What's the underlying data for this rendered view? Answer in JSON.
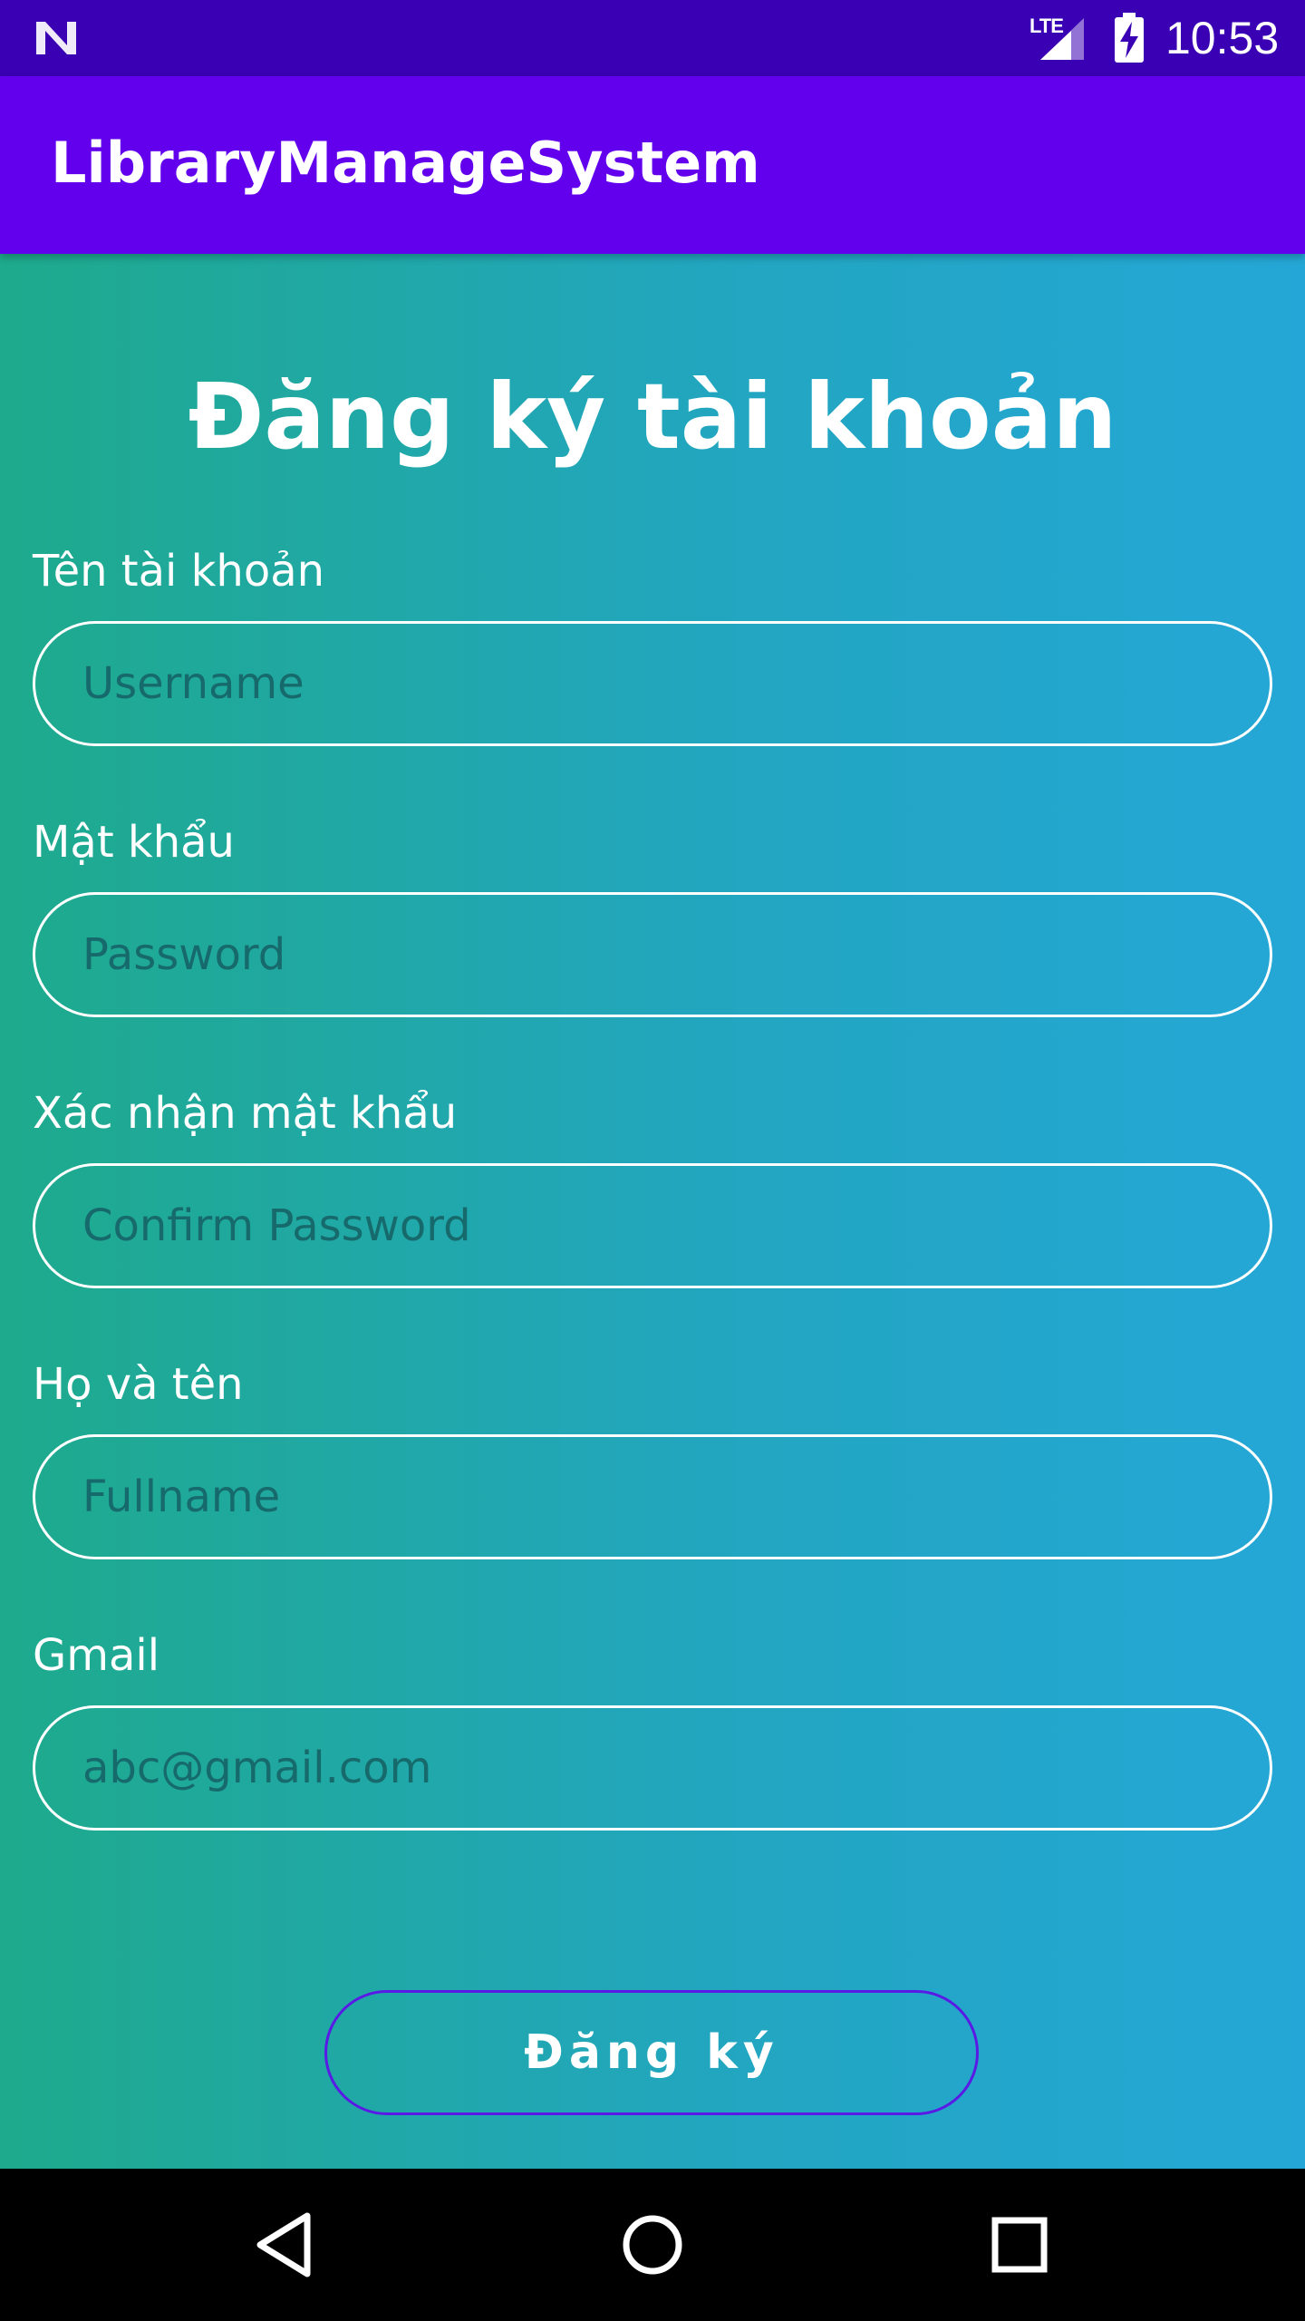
{
  "status_bar": {
    "network_label": "LTE",
    "time": "10:53",
    "icons": [
      "n-logo-icon",
      "signal-icon",
      "battery-charging-icon"
    ]
  },
  "app_bar": {
    "title": "LibraryManageSystem"
  },
  "form": {
    "heading": "Đăng ký tài khoản",
    "fields": [
      {
        "label": "Tên tài khoản",
        "placeholder": "Username",
        "value": ""
      },
      {
        "label": "Mật khẩu",
        "placeholder": "Password",
        "value": ""
      },
      {
        "label": "Xác nhận mật khẩu",
        "placeholder": "Confirm Password",
        "value": ""
      },
      {
        "label": "Họ và tên",
        "placeholder": "Fullname",
        "value": ""
      },
      {
        "label": "Gmail",
        "placeholder": "abc@gmail.com",
        "value": ""
      }
    ],
    "submit_label": "Đăng ký"
  },
  "nav_bar": {
    "icons": [
      "back-icon",
      "home-icon",
      "recents-icon"
    ]
  },
  "colors": {
    "status_bar": "#3A00B3",
    "app_bar": "#6200EE",
    "gradient_start": "#1EAA8C",
    "gradient_end": "#24A7D6",
    "button_border": "#5A1AE6"
  }
}
